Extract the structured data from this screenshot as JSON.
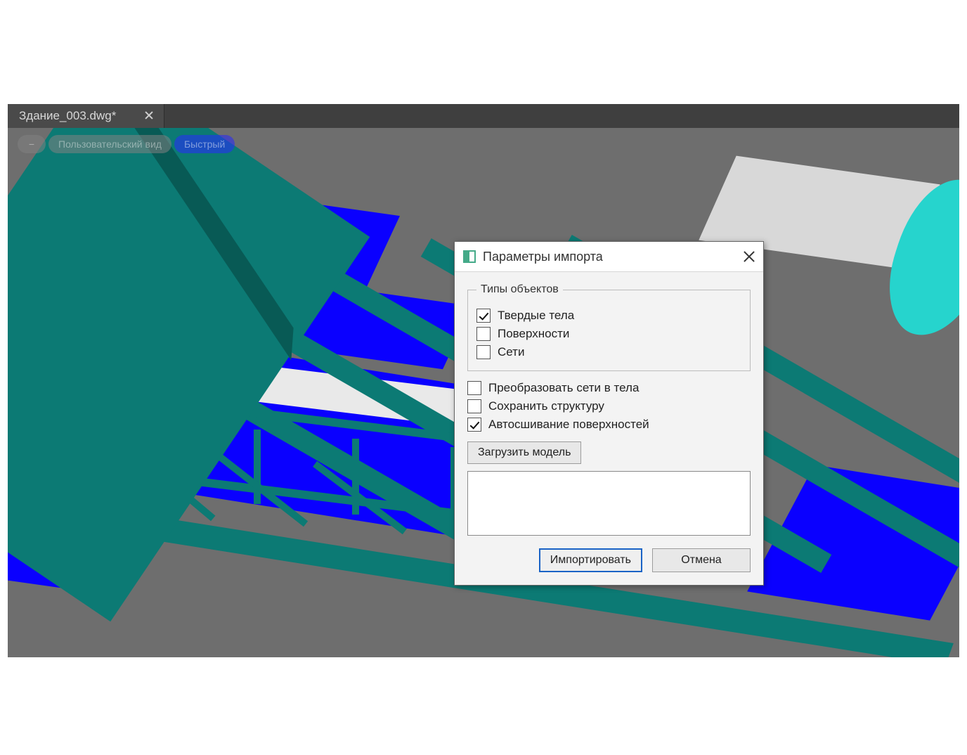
{
  "tab": {
    "title": "Здание_003.dwg*"
  },
  "pills": {
    "minus": "−",
    "view": "Пользовательский вид",
    "mode": "Быстрый"
  },
  "dialog": {
    "title": "Параметры импорта",
    "group_label": "Типы объектов",
    "checkboxes": {
      "solids": {
        "label": "Твердые тела",
        "checked": true
      },
      "surfaces": {
        "label": "Поверхности",
        "checked": false
      },
      "meshes": {
        "label": "Сети",
        "checked": false
      },
      "convert": {
        "label": "Преобразовать сети в тела",
        "checked": false
      },
      "keep": {
        "label": "Сохранить структуру",
        "checked": false
      },
      "autostitch": {
        "label": "Автосшивание поверхностей",
        "checked": true
      }
    },
    "load_model_btn": "Загрузить модель",
    "import_btn": "Импортировать",
    "cancel_btn": "Отмена"
  }
}
